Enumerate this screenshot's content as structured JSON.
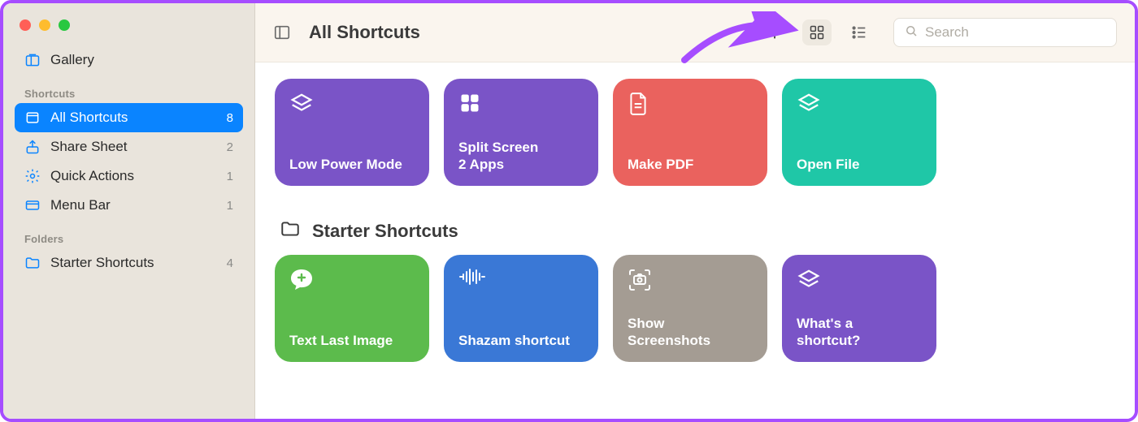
{
  "traffic_lights": [
    "close",
    "minimize",
    "zoom"
  ],
  "sidebar": {
    "top_items": [
      {
        "icon": "gallery-icon",
        "label": "Gallery",
        "count": ""
      }
    ],
    "heading_shortcuts": "Shortcuts",
    "shortcut_items": [
      {
        "icon": "all-icon",
        "label": "All Shortcuts",
        "count": "8",
        "selected": true
      },
      {
        "icon": "share-icon",
        "label": "Share Sheet",
        "count": "2",
        "selected": false
      },
      {
        "icon": "gear-icon",
        "label": "Quick Actions",
        "count": "1",
        "selected": false
      },
      {
        "icon": "menubar-icon",
        "label": "Menu Bar",
        "count": "1",
        "selected": false
      }
    ],
    "heading_folders": "Folders",
    "folder_items": [
      {
        "icon": "folder-icon",
        "label": "Starter Shortcuts",
        "count": "4"
      }
    ]
  },
  "toolbar": {
    "title": "All Shortcuts",
    "search_placeholder": "Search"
  },
  "top_cards": [
    {
      "title": "Low Power Mode",
      "color": "#7a54c7",
      "icon": "layers"
    },
    {
      "title": "Split Screen\n2 Apps",
      "color": "#7a54c7",
      "icon": "grid4"
    },
    {
      "title": "Make PDF",
      "color": "#ea625e",
      "icon": "file"
    },
    {
      "title": "Open File",
      "color": "#1fc7a7",
      "icon": "layers"
    }
  ],
  "starter_section": {
    "title": "Starter Shortcuts",
    "cards": [
      {
        "title": "Text Last Image",
        "color": "#5cbb4c",
        "icon": "chat-plus"
      },
      {
        "title": "Shazam shortcut",
        "color": "#3a78d6",
        "icon": "wave"
      },
      {
        "title": "Show\nScreenshots",
        "color": "#a49c93",
        "icon": "camera-corners"
      },
      {
        "title": "What's a\nshortcut?",
        "color": "#7a54c7",
        "icon": "layers"
      }
    ]
  },
  "annotation": {
    "arrow_color": "#a64dff"
  }
}
